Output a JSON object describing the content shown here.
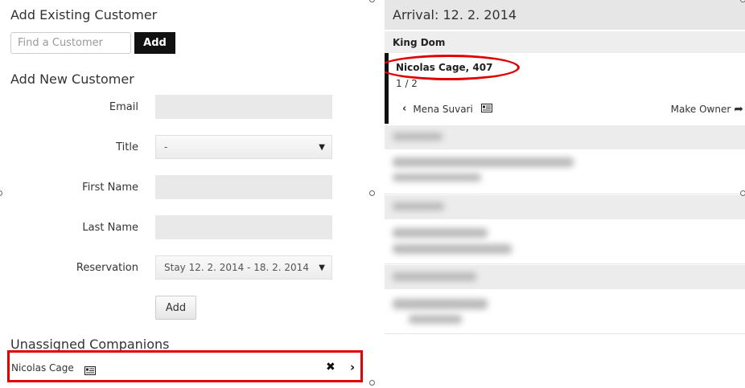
{
  "existing": {
    "title": "Add Existing Customer",
    "search_placeholder": "Find a Customer",
    "add_label": "Add"
  },
  "new_customer": {
    "title": "Add New Customer",
    "fields": {
      "email": {
        "label": "Email",
        "value": ""
      },
      "title": {
        "label": "Title",
        "value": "-"
      },
      "first_name": {
        "label": "First Name",
        "value": ""
      },
      "last_name": {
        "label": "Last Name",
        "value": ""
      },
      "reservation": {
        "label": "Reservation",
        "value": "Stay 12. 2. 2014 - 18. 2. 2014"
      }
    },
    "add_label": "Add"
  },
  "companions": {
    "title": "Unassigned Companions",
    "items": [
      {
        "name": "Nicolas Cage"
      }
    ]
  },
  "arrival": {
    "header": "Arrival: 12. 2. 2014",
    "group_name": "King Dom",
    "guest": {
      "name": "Nicolas Cage, 407",
      "pager": "1 / 2",
      "prev_name": "Mena Suvari",
      "make_owner_label": "Make Owner"
    }
  },
  "colors": {
    "highlight": "#e00000",
    "dark_button": "#111111",
    "header_bg": "#e6e6e6"
  },
  "icons": {
    "card": "id-card-icon",
    "remove": "close-icon",
    "go": "chevron-right-icon",
    "back": "chevron-left-icon",
    "owner": "share-arrow-icon",
    "dropdown": "caret-down-icon"
  }
}
